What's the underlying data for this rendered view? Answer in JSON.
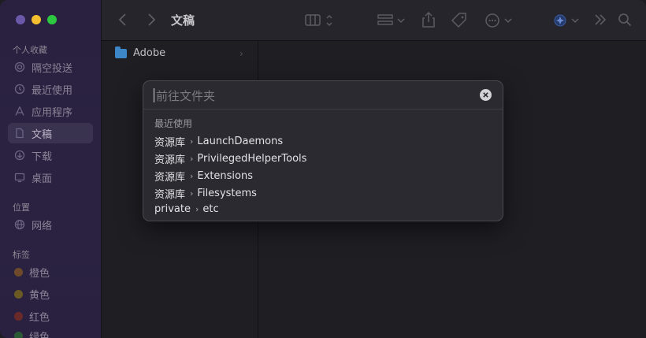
{
  "window": {
    "title": "文稿"
  },
  "sidebar": {
    "favorites_label": "个人收藏",
    "favorites": [
      {
        "label": "隔空投送",
        "icon": "airdrop-icon"
      },
      {
        "label": "最近使用",
        "icon": "clock-icon"
      },
      {
        "label": "应用程序",
        "icon": "applications-icon"
      },
      {
        "label": "文稿",
        "icon": "document-icon",
        "active": true
      },
      {
        "label": "下载",
        "icon": "download-icon"
      },
      {
        "label": "桌面",
        "icon": "desktop-icon"
      }
    ],
    "locations_label": "位置",
    "locations": [
      {
        "label": "网络",
        "icon": "globe-icon"
      }
    ],
    "tags_label": "标签",
    "tags": [
      {
        "label": "橙色",
        "color": "#6e4a2a"
      },
      {
        "label": "黄色",
        "color": "#6b5a24"
      },
      {
        "label": "红色",
        "color": "#6b2a2a"
      },
      {
        "label": "绿色",
        "color": "#2a5a33"
      }
    ]
  },
  "browser": {
    "items": [
      {
        "label": "Adobe",
        "icon": "folder-icon"
      }
    ]
  },
  "goto": {
    "placeholder": "前往文件夹",
    "recent_label": "最近使用",
    "results": [
      {
        "parent": "资源库",
        "child": "LaunchDaemons"
      },
      {
        "parent": "资源库",
        "child": "PrivilegedHelperTools"
      },
      {
        "parent": "资源库",
        "child": "Extensions"
      },
      {
        "parent": "资源库",
        "child": "Filesystems"
      },
      {
        "parent": "private",
        "child": "etc"
      }
    ]
  }
}
